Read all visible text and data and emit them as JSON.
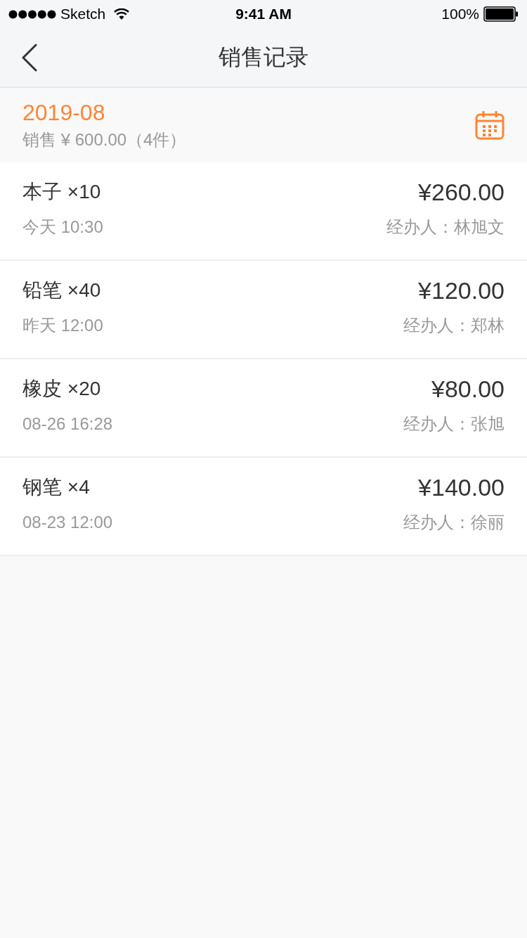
{
  "status_bar": {
    "carrier": "Sketch",
    "time": "9:41 AM",
    "battery": "100%"
  },
  "nav": {
    "title": "销售记录"
  },
  "month": {
    "date": "2019-08",
    "summary": "销售 ¥ 600.00（4件）"
  },
  "records": [
    {
      "name": "本子 ×10",
      "time": "今天 10:30",
      "price": "¥260.00",
      "handler": "经办人：林旭文"
    },
    {
      "name": "铅笔 ×40",
      "time": "昨天 12:00",
      "price": "¥120.00",
      "handler": "经办人：郑林"
    },
    {
      "name": "橡皮 ×20",
      "time": "08-26 16:28",
      "price": "¥80.00",
      "handler": "经办人：张旭"
    },
    {
      "name": "钢笔 ×4",
      "time": "08-23 12:00",
      "price": "¥140.00",
      "handler": "经办人：徐丽"
    }
  ]
}
